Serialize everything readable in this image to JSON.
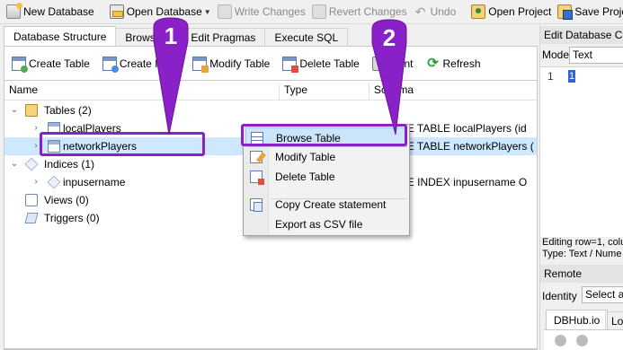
{
  "toolbar": {
    "new_database": "New Database",
    "open_database": "Open Database",
    "write_changes": "Write Changes",
    "revert_changes": "Revert Changes",
    "undo": "Undo",
    "open_project": "Open Project",
    "save_project": "Save Proje"
  },
  "tabs": [
    "Database Structure",
    "Browse D",
    "Edit Pragmas",
    "Execute SQL"
  ],
  "actions": {
    "create_table": "Create Table",
    "create_index": "Create In",
    "modify_table": "Modify Table",
    "delete_table": "Delete Table",
    "print": "rint",
    "refresh": "Refresh"
  },
  "tree": {
    "columns": [
      "Name",
      "Type",
      "Schema"
    ],
    "rows": [
      {
        "label": "Tables (2)",
        "schema": ""
      },
      {
        "label": "localPlayers",
        "schema": "CREATE TABLE localPlayers (id"
      },
      {
        "label": "networkPlayers",
        "schema": "CREATE TABLE networkPlayers ("
      },
      {
        "label": "Indices (1)",
        "schema": ""
      },
      {
        "label": "inpusername",
        "schema": "CREATE INDEX inpusername O"
      },
      {
        "label": "Views (0)",
        "schema": ""
      },
      {
        "label": "Triggers (0)",
        "schema": ""
      }
    ]
  },
  "context_menu": {
    "items": [
      "Browse Table",
      "Modify Table",
      "Delete Table",
      "Copy Create statement",
      "Export as CSV file"
    ]
  },
  "annotations": {
    "badge1": "1",
    "badge2": "2",
    "color": "#8a20c8"
  },
  "right_pane": {
    "title": "Edit Database Ce",
    "mode_label": "Mode:",
    "mode_value": "Text",
    "line_number": "1",
    "cell_value": "1",
    "status_line1": "Editing row=1, colu",
    "status_line2": "Type: Text / Nume",
    "remote_title": "Remote",
    "identity_label": "Identity",
    "identity_value": "Select an",
    "tab_dbhub": "DBHub.io",
    "tab_local": "Lo"
  }
}
